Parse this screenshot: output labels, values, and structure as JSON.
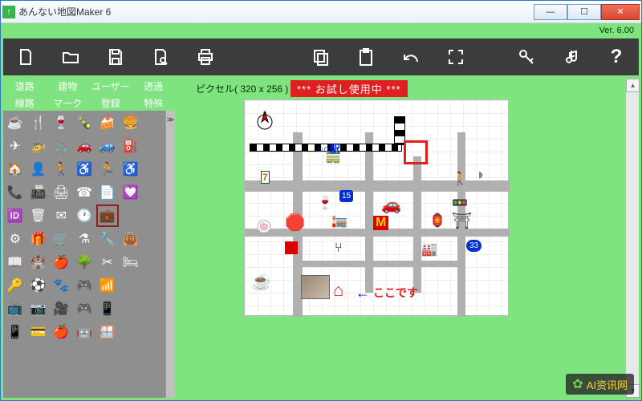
{
  "window": {
    "title": "あんない地図Maker 6"
  },
  "version_label": "Ver. 6.00",
  "toolbar": {
    "new": "new-file",
    "open": "open",
    "save": "save",
    "pageview": "page-view",
    "print": "print",
    "copy": "copy",
    "paste": "paste",
    "undo": "undo",
    "fit": "fit-screen",
    "key": "key",
    "note": "sound",
    "help": "?"
  },
  "tabs": {
    "r1": [
      "道路",
      "建物",
      "ユーザー",
      "透過"
    ],
    "r2": [
      "線路",
      "マーク",
      "登録",
      "特殊"
    ]
  },
  "palette_icons": [
    "☕",
    "🍴",
    "🍷",
    "🍾",
    "🍰",
    "🍔",
    "",
    "✈",
    "🚁",
    "🚲",
    "🚗",
    "🚙",
    "⛽",
    "",
    "🏠",
    "👤",
    "🚶",
    "♿",
    "🏃",
    "♿",
    "",
    "📞",
    "📠",
    "🖨",
    "☎",
    "📄",
    "💟",
    "",
    "🆔",
    "🗑",
    "✉",
    "🕐",
    "💼",
    "",
    "",
    "⚙",
    "🎁",
    "🛒",
    "⚗",
    "🔧",
    "👜",
    "",
    "📖",
    "🏰",
    "🍎",
    "🌳",
    "✂",
    "🛏",
    "",
    "🔑",
    "⚽",
    "🐾",
    "🎮",
    "📶",
    "",
    "",
    "📺",
    "📷",
    "🎥",
    "🎮",
    "📱",
    "",
    "",
    "📱",
    "💳",
    "🍎",
    "🤖",
    "🪟",
    ""
  ],
  "selected_icon_index": 32,
  "canvas": {
    "pixel_label": "ピクセル( 320 x 256 )",
    "trial_label": "*** お試し使用中 ***",
    "station_label": "○○駅",
    "route_badge": "15",
    "route_badge2": "33",
    "here_label": "ここです",
    "arrow": "←"
  },
  "watermark": "AI资讯网"
}
